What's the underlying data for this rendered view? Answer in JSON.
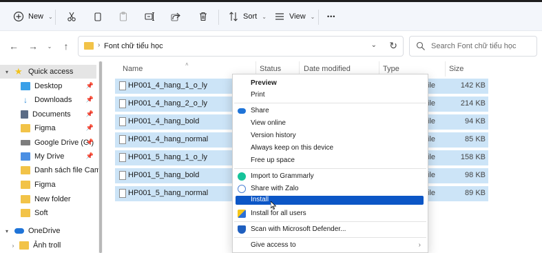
{
  "toolbar": {
    "new_label": "New",
    "sort_label": "Sort",
    "view_label": "View",
    "more_label": "•••"
  },
  "address": {
    "path": "Font chữ tiểu học",
    "search_placeholder": "Search Font chữ tiểu học"
  },
  "sidebar": {
    "items": [
      {
        "label": "Quick access",
        "icon": "star-icon",
        "color": "#f2c21b"
      },
      {
        "label": "Desktop",
        "icon": "desktop-icon",
        "color": "#3aa0e8"
      },
      {
        "label": "Downloads",
        "icon": "download-icon",
        "color": "#2c8ad8"
      },
      {
        "label": "Documents",
        "icon": "document-icon",
        "color": "#5a6b85"
      },
      {
        "label": "Figma",
        "icon": "folder-icon",
        "color": "#f2c348"
      },
      {
        "label": "Google Drive (G:)",
        "icon": "drive-icon",
        "color": "#7d7d7d"
      },
      {
        "label": "My Drive",
        "icon": "drive-folder-icon",
        "color": "#4b8fe3"
      },
      {
        "label": "Danh sách file Camtas",
        "icon": "folder-icon",
        "color": "#f2c348"
      },
      {
        "label": "Figma",
        "icon": "folder-icon",
        "color": "#f2c348"
      },
      {
        "label": "New folder",
        "icon": "folder-icon",
        "color": "#f2c348"
      },
      {
        "label": "Soft",
        "icon": "folder-icon",
        "color": "#f2c348"
      },
      {
        "label": "OneDrive",
        "icon": "cloud-icon",
        "color": "#1f74d8"
      },
      {
        "label": "Ảnh troll",
        "icon": "folder-icon",
        "color": "#f2c348"
      }
    ]
  },
  "columns": {
    "name": "Name",
    "status": "Status",
    "date": "Date modified",
    "type": "Type",
    "size": "Size"
  },
  "files": [
    {
      "name": "HP001_4_hang_1_o_ly",
      "type_fragment": "ile",
      "size": "142 KB"
    },
    {
      "name": "HP001_4_hang_2_o_ly",
      "type_fragment": "ile",
      "size": "214 KB"
    },
    {
      "name": "HP001_4_hang_bold",
      "type_fragment": "ile",
      "size": "94 KB"
    },
    {
      "name": "HP001_4_hang_normal",
      "type_fragment": "ile",
      "size": "85 KB"
    },
    {
      "name": "HP001_5_hang_1_o_ly",
      "type_fragment": "ile",
      "size": "158 KB"
    },
    {
      "name": "HP001_5_hang_bold",
      "type_fragment": "ile",
      "size": "98 KB"
    },
    {
      "name": "HP001_5_hang_normal",
      "type_fragment": "ile",
      "size": "89 KB"
    }
  ],
  "context_menu": {
    "preview": "Preview",
    "print": "Print",
    "share": "Share",
    "view_online": "View online",
    "version_history": "Version history",
    "keep_on_device": "Always keep on this device",
    "free_up_space": "Free up space",
    "grammarly": "Import to Grammarly",
    "zalo": "Share with Zalo",
    "install": "Install",
    "install_all": "Install for all users",
    "defender": "Scan with Microsoft Defender...",
    "give_access": "Give access to"
  },
  "colors": {
    "selection": "#cce4f7",
    "highlight": "#0c56c6"
  }
}
